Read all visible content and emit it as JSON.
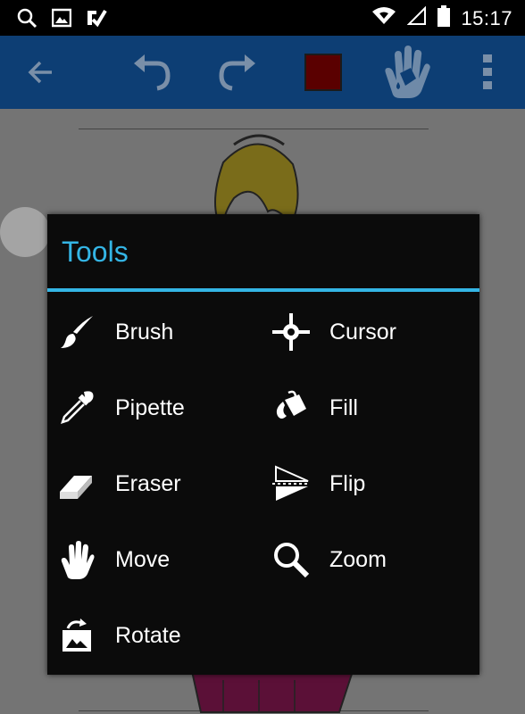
{
  "status_bar": {
    "time": "15:17",
    "icons": [
      "search-icon",
      "image-icon",
      "check-app-icon",
      "wifi-icon",
      "signal-icon",
      "battery-icon"
    ]
  },
  "toolbar": {
    "icons": [
      "back-arrow-icon",
      "undo-icon",
      "redo-icon",
      "color-swatch",
      "hand-fill-icon",
      "overflow-menu-icon"
    ],
    "current_color": "#5a0000"
  },
  "dialog": {
    "title": "Tools",
    "accent": "#34b5e5",
    "tools": [
      {
        "label": "Brush",
        "icon": "brush-icon"
      },
      {
        "label": "Cursor",
        "icon": "crosshair-icon"
      },
      {
        "label": "Pipette",
        "icon": "pipette-icon"
      },
      {
        "label": "Fill",
        "icon": "fill-bucket-icon"
      },
      {
        "label": "Eraser",
        "icon": "eraser-icon"
      },
      {
        "label": "Flip",
        "icon": "flip-icon"
      },
      {
        "label": "Move",
        "icon": "hand-icon"
      },
      {
        "label": "Zoom",
        "icon": "magnifier-icon"
      },
      {
        "label": "Rotate",
        "icon": "rotate-icon"
      }
    ]
  }
}
